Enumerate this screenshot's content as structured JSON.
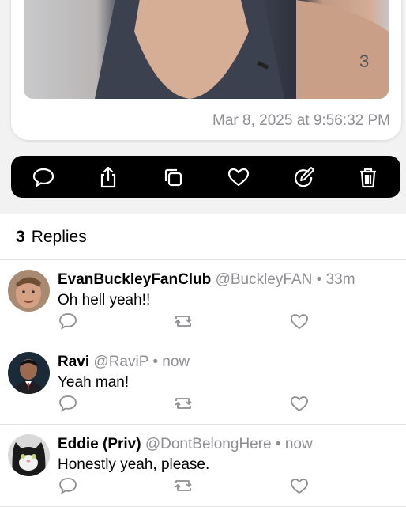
{
  "post": {
    "timestamp": "Mar 8, 2025 at 9:56:32 PM"
  },
  "toolbar": {
    "icons": [
      "comment-icon",
      "share-icon",
      "copy-icon",
      "heart-icon",
      "edit-icon",
      "trash-icon"
    ]
  },
  "replies_section": {
    "count": "3",
    "label": "Replies"
  },
  "replies": [
    {
      "name": "EvanBuckleyFanClub",
      "handle": "@BuckleyFAN",
      "dot": "•",
      "time": "33m",
      "text": "Oh hell yeah!!"
    },
    {
      "name": "Ravi",
      "handle": "@RaviP",
      "dot": "•",
      "time": "now",
      "text": "Yeah man!"
    },
    {
      "name": "Eddie (Priv)",
      "handle": "@DontBelongHere",
      "dot": "•",
      "time": "now",
      "text": "Honestly yeah, please."
    }
  ]
}
